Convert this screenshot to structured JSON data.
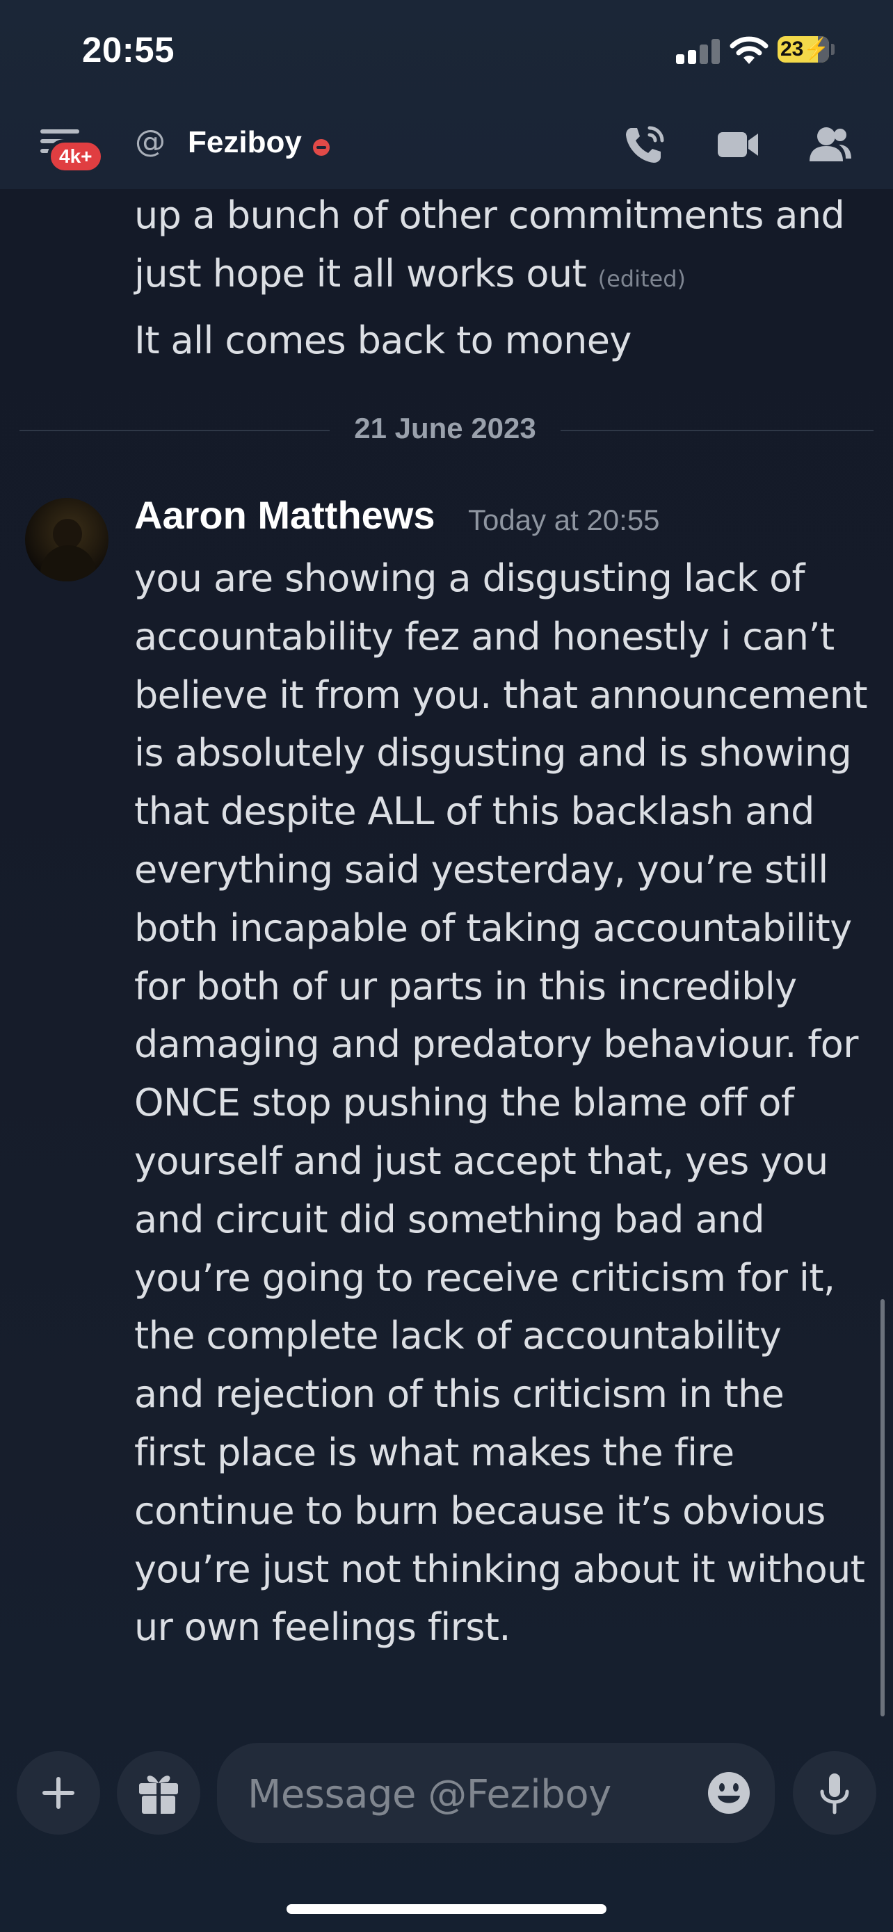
{
  "status_bar": {
    "time": "20:55",
    "battery": "23"
  },
  "header": {
    "notification_badge": "4k+",
    "at_symbol": "@",
    "channel_name": "Feziboy",
    "icons": [
      "menu-icon",
      "call-icon",
      "video-icon",
      "members-icon"
    ]
  },
  "previous_messages": {
    "line1": "up a bunch of other commitments and",
    "line2": "just hope it all works out",
    "edited_label": "(edited)",
    "line3": "It all comes back to money"
  },
  "date_divider": "21 June 2023",
  "message": {
    "author": "Aaron Matthews",
    "timestamp": "Today at 20:55",
    "lines": [
      "you are showing a disgusting lack of",
      "accountability fez and honestly i can’t",
      "believe it from you. that announcement",
      "is absolutely disgusting and is showing",
      "that despite ALL of this backlash and",
      "everything said yesterday, you’re still",
      "both incapable of taking accountability",
      "for both of ur parts in this incredibly",
      "damaging and predatory behaviour. for",
      "ONCE stop pushing the blame off of",
      "yourself and just accept that, yes you",
      "and circuit did something bad and",
      "you’re going to receive criticism for it,",
      "the complete lack of accountability",
      "and rejection of this criticism in the",
      "first place is what makes the fire",
      "continue to burn because it’s obvious",
      "you’re just not thinking about it without",
      "ur own feelings first."
    ]
  },
  "composer": {
    "placeholder": "Message @Feziboy",
    "buttons": [
      "plus-icon",
      "gift-icon",
      "emoji-icon",
      "microphone-icon"
    ]
  },
  "colors": {
    "background": "#151b29",
    "header": "#1a2435",
    "badge": "#e03e41",
    "dnd_status": "#e14a48",
    "battery": "#f3d94a"
  }
}
